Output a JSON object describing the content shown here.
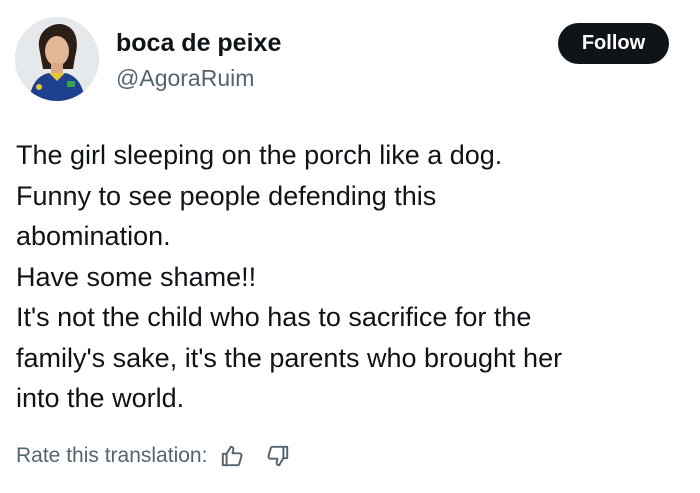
{
  "author": {
    "display_name": "boca de peixe",
    "handle": "@AgoraRuim",
    "avatar_icon": "user-avatar-photo"
  },
  "actions": {
    "follow_label": "Follow"
  },
  "tweet": {
    "lines": [
      "The girl sleeping on the porch like a dog.",
      "Funny to see people defending this",
      "abomination.",
      "Have some shame!!",
      "It's not the child who has to sacrifice for the",
      "family's sake, it's the parents who brought her",
      "into the world."
    ]
  },
  "translation": {
    "label": "Rate this translation:",
    "thumbs_up_icon": "thumbs-up-icon",
    "thumbs_down_icon": "thumbs-down-icon"
  },
  "colors": {
    "text_primary": "#0f1419",
    "text_secondary": "#536471",
    "follow_bg": "#0f1419",
    "follow_text": "#ffffff",
    "background": "#ffffff"
  }
}
